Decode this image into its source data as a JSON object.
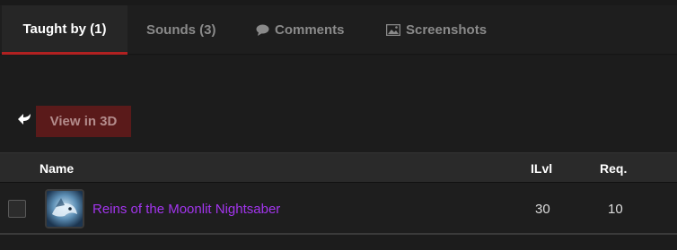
{
  "tabs": [
    {
      "label": "Taught by (1)",
      "active": true
    },
    {
      "label": "Sounds (3)",
      "active": false
    },
    {
      "label": "Comments",
      "icon": "comment-bubble-icon",
      "active": false
    },
    {
      "label": "Screenshots",
      "icon": "image-icon",
      "active": false
    }
  ],
  "viewer": {
    "back_icon": "curved-arrow-icon",
    "view3d_label": "View in 3D"
  },
  "table": {
    "columns": [
      "Name",
      "ILvl",
      "Req."
    ],
    "rows": [
      {
        "name": "Reins of the Moonlit Nightsaber",
        "ilvl": "30",
        "req": "10",
        "quality_color": "#a335ee",
        "icon": "nightsaber-mount-icon"
      }
    ]
  },
  "colors": {
    "accent": "#b12121",
    "epic": "#a335ee",
    "button_bg": "#5a1a1a"
  }
}
